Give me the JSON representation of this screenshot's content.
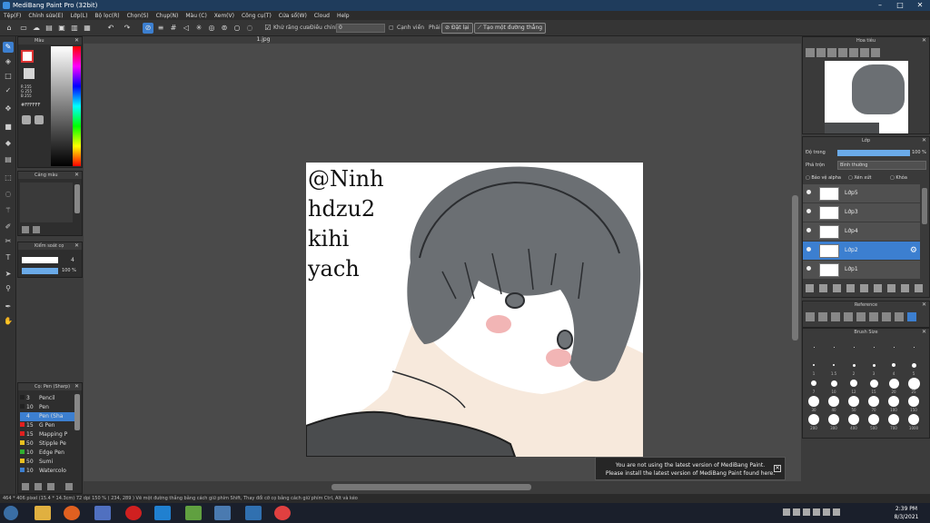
{
  "app": {
    "title": "MediBang Paint Pro (32bit)"
  },
  "menu": [
    "Tệp(F)",
    "Chỉnh sửa(E)",
    "Lớp(L)",
    "Bộ lọc(R)",
    "Chọn(S)",
    "Chụp(N)",
    "Màu (C)",
    "Xem(V)",
    "Công cụ(T)",
    "Cửa sổ(W)",
    "Cloud",
    "Help"
  ],
  "toolbar": {
    "antialias_label": "Khử răng cưa",
    "adjust_label": "Điều chỉnh",
    "adjust_value": "0",
    "snap_label": "Cạnh viền",
    "pen_label": "Phải",
    "setting_label": "Đặt lại",
    "straight_label": "Tạo một đường thẳng"
  },
  "color_panel": {
    "title": "Màu",
    "rgb_r": "R 255",
    "rgb_g": "G 255",
    "rgb_b": "B 255",
    "hex": "#FFFFFF"
  },
  "palette_panel": {
    "title": "Cảng màu"
  },
  "brush_control": {
    "title": "Kiểm soát cọ",
    "size_value": "4",
    "opacity_value": "100 %"
  },
  "brush_panel": {
    "title": "Cọ: Pen (Sharp)",
    "items": [
      {
        "size": "3",
        "name": "Pencil",
        "color": "#222222"
      },
      {
        "size": "10",
        "name": "Pen",
        "color": "#222222"
      },
      {
        "size": "4",
        "name": "Pen (Sha",
        "color": "#3c7fd0"
      },
      {
        "size": "15",
        "name": "G Pen",
        "color": "#e02020"
      },
      {
        "size": "15",
        "name": "Mapping P",
        "color": "#e02020"
      },
      {
        "size": "50",
        "name": "Stipple Pe",
        "color": "#e8c020"
      },
      {
        "size": "10",
        "name": "Edge Pen",
        "color": "#30b030"
      },
      {
        "size": "50",
        "name": "Sumi",
        "color": "#e8c020"
      },
      {
        "size": "10",
        "name": "Watercolo",
        "color": "#3c7fd0"
      }
    ]
  },
  "canvas": {
    "tab": "1.jpg",
    "text_lines": [
      "@Ninh",
      "hdzu2",
      "kihi",
      "yach"
    ]
  },
  "navigator": {
    "title": "Hoa tiêu"
  },
  "layers": {
    "title": "Lớp",
    "opacity_label": "Độ trong",
    "opacity_value": "100 %",
    "blend_label": "Phá trộn",
    "blend_value": "Bình thường",
    "protect_alpha": "Bảo vệ alpha",
    "clipping": "Xén xứt",
    "lock": "Khóa",
    "items": [
      {
        "name": "Lớp5",
        "selected": false
      },
      {
        "name": "Lớp3",
        "selected": false
      },
      {
        "name": "Lớp4",
        "selected": false
      },
      {
        "name": "Lớp2",
        "selected": true
      },
      {
        "name": "Lớp1",
        "selected": false
      }
    ]
  },
  "reference": {
    "title": "Reference"
  },
  "brush_size": {
    "title": "Brush Size",
    "labels": [
      "",
      "",
      "",
      "",
      "",
      "",
      "1",
      "1.5",
      "2",
      "3",
      "4",
      "5",
      "7",
      "10",
      "12",
      "15",
      "20",
      "25",
      "30",
      "40",
      "50",
      "70",
      "100",
      "150",
      "200",
      "300",
      "400",
      "500",
      "700",
      "1000"
    ]
  },
  "notice": {
    "line1": "You are not using the latest version of MediBang Paint.",
    "line2": "Please install the latest version of MediBang Paint found here."
  },
  "status": {
    "text": "464 * 406 pixel   (15.4 * 14.3cm)   72 dpi   150 %   ( 234, 289 )   Vẽ một đường thẳng bằng cách giữ phím Shift, Thay đổi cỡ cọ bằng cách giữ phím Ctrl, Alt và kéo"
  },
  "clock": {
    "time": "2:39 PM",
    "date": "8/3/2021"
  }
}
